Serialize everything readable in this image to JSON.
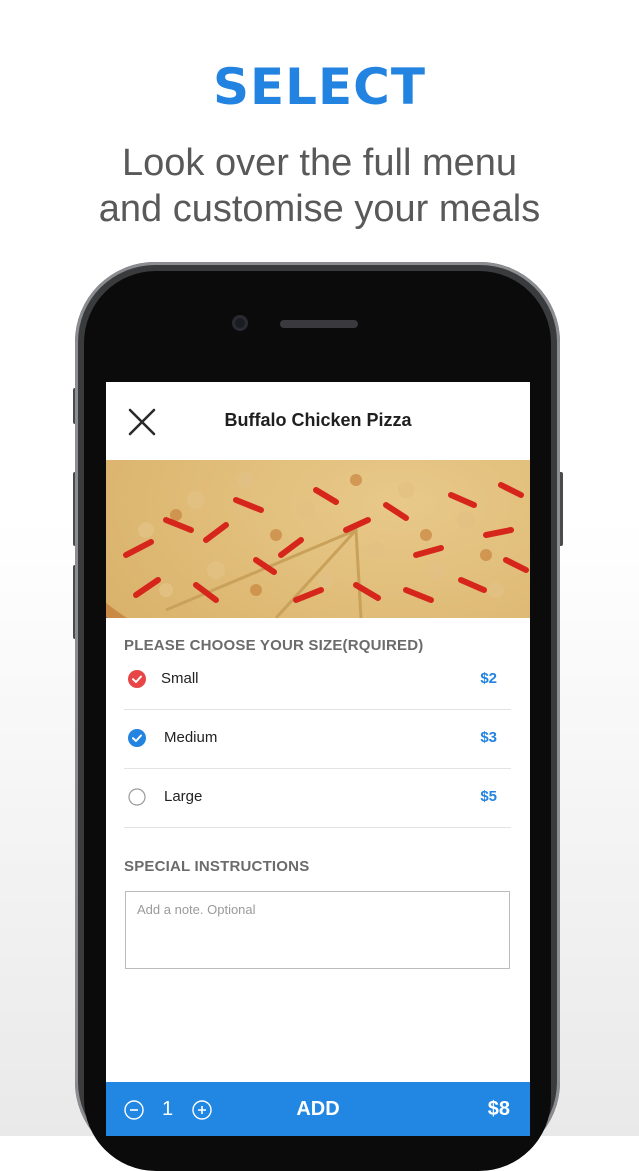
{
  "promo": {
    "headline": "SELECT",
    "subline_line1": "Look over the full menu",
    "subline_line2": "and customise your meals"
  },
  "item": {
    "title": "Buffalo Chicken Pizza",
    "image_icon": "pizza-photo"
  },
  "size_section": {
    "label": "PLEASE  CHOOSE YOUR SIZE(RQUIRED)",
    "options": [
      {
        "label": "Small",
        "price": "$2",
        "state": "checked",
        "color": "#e84646"
      },
      {
        "label": "Medium",
        "price": "$3",
        "state": "checked",
        "color": "#2383e0"
      },
      {
        "label": "Large",
        "price": "$5",
        "state": "unchecked",
        "color": "#9a9a9a"
      }
    ]
  },
  "instructions": {
    "label": "SPECIAL INSTRUCTIONS",
    "value": "",
    "placeholder": "Add a note. Optional"
  },
  "order_bar": {
    "quantity": "1",
    "add_label": "ADD",
    "total": "$8",
    "color": "#2187e3"
  },
  "colors": {
    "accent": "#2383e0",
    "check_red": "#e84646"
  }
}
